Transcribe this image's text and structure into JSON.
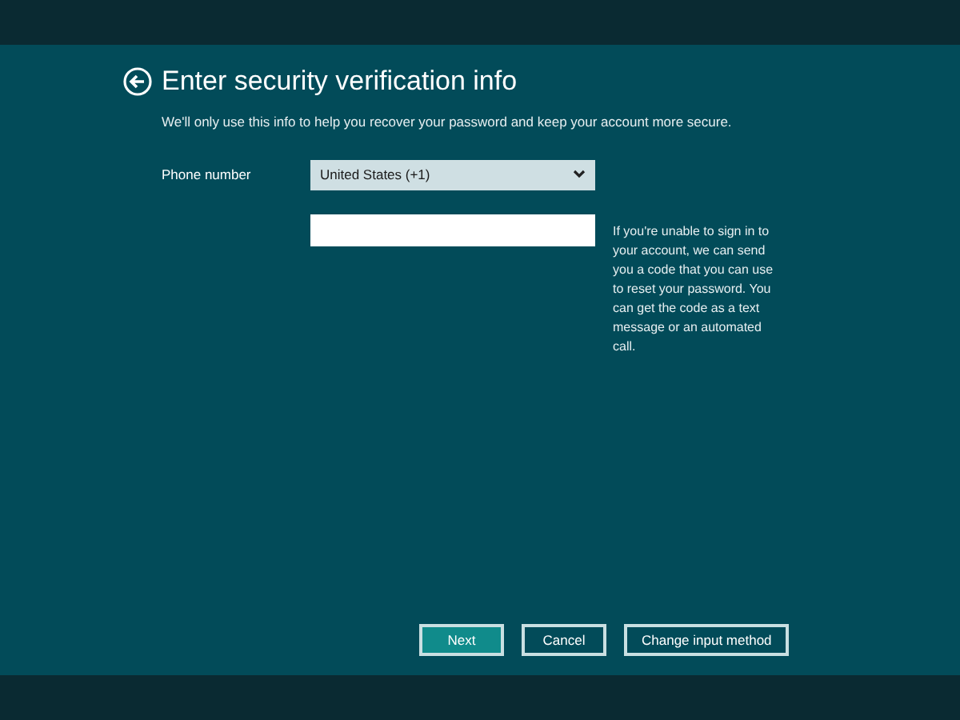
{
  "title": "Enter security verification info",
  "subtitle": "We'll only use this info to help you recover your password and keep your account more secure.",
  "phone": {
    "label": "Phone number",
    "country": "United States (+1)",
    "help": "If you're unable to sign in to your account, we can send you a code that you can use to reset your password. You can get the code as a text message or an automated call."
  },
  "buttons": [
    {
      "label": "Next",
      "kind": "primary"
    },
    {
      "label": "Cancel",
      "kind": "outline"
    },
    {
      "label": "Change input method",
      "kind": "outline"
    }
  ]
}
